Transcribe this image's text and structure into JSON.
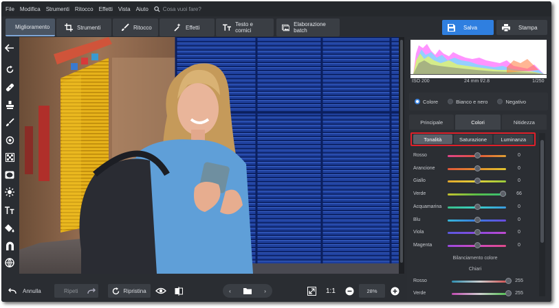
{
  "menu": {
    "items": [
      "File",
      "Modifica",
      "Strumenti",
      "Ritocco",
      "Effetti",
      "Vista",
      "Aiuto"
    ],
    "search_placeholder": "Cosa vuoi fare?"
  },
  "toolbar": {
    "tabs": [
      {
        "label": "Miglioramento",
        "icon": "sliders-icon",
        "active": true
      },
      {
        "label": "Strumenti",
        "icon": "crop-icon",
        "active": false
      },
      {
        "label": "Ritocco",
        "icon": "brush-icon",
        "active": false
      },
      {
        "label": "Effetti",
        "icon": "magic-wand-icon",
        "active": false
      },
      {
        "label": "Testo e cornici",
        "icon": "text-icon",
        "active": false
      }
    ],
    "batch_label": "Elaborazione batch",
    "save_label": "Salva",
    "print_label": "Stampa"
  },
  "left_tools": [
    "back-arrow-icon",
    "rotate-icon",
    "bandage-icon",
    "stamp-icon",
    "brush-icon",
    "focus-icon",
    "gradient-icon",
    "vignette-icon",
    "sun-icon",
    "text-size-icon",
    "fill-bucket-icon",
    "magnet-icon",
    "globe-icon"
  ],
  "histogram": {
    "iso": "ISO 200",
    "lens": "24 mm f/2.8",
    "shutter": "1/250"
  },
  "color_mode": {
    "options": [
      "Colore",
      "Bianco e nero",
      "Negativo"
    ],
    "selected": "Colore"
  },
  "panel_tabs": {
    "items": [
      "Principale",
      "Colori",
      "Nitidezza"
    ],
    "active": "Colori"
  },
  "sub_tabs": {
    "items": [
      "Tonalità",
      "Saturazione",
      "Luminanza"
    ],
    "active": "Tonalità"
  },
  "hue_sliders": [
    {
      "label": "Rosso",
      "value": "0",
      "position": 0.5
    },
    {
      "label": "Arancione",
      "value": "0",
      "position": 0.5
    },
    {
      "label": "Giallo",
      "value": "0",
      "position": 0.5
    },
    {
      "label": "Verde",
      "value": "66",
      "position": 0.94
    },
    {
      "label": "Acquamarina",
      "value": "0",
      "position": 0.5
    },
    {
      "label": "Blu",
      "value": "0",
      "position": 0.5
    },
    {
      "label": "Viola",
      "value": "0",
      "position": 0.5
    },
    {
      "label": "Magenta",
      "value": "0",
      "position": 0.5
    }
  ],
  "color_balance": {
    "title": "Bilanciamento colore",
    "subtitle": "Chiari",
    "sliders": [
      {
        "label": "Rosso",
        "value": "255",
        "position": 1.0
      },
      {
        "label": "Verde",
        "value": "255",
        "position": 1.0
      }
    ]
  },
  "bottom": {
    "undo_label": "Annulla",
    "redo_label": "Ripeti",
    "reset_label": "Ripristina",
    "zoom_ratio": "1:1",
    "zoom_value": "28%"
  },
  "colors": {
    "accent": "#2f7fe0",
    "highlight": "#e0202a"
  }
}
